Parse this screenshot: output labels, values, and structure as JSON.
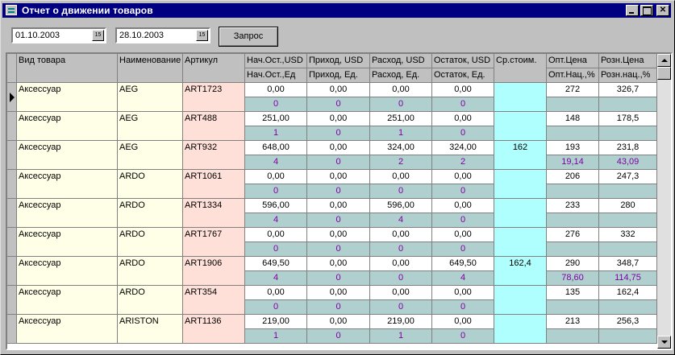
{
  "window": {
    "title": "Отчет о движении товаров"
  },
  "toolbar": {
    "date_from": "01.10.2003",
    "date_to": "28.10.2003",
    "calendar_label": "15",
    "query_label": "Запрос"
  },
  "grid": {
    "headers": {
      "type": "Вид товара",
      "name": "Наименование",
      "article": "Артикул",
      "start_usd": "Нач.Ост.,USD",
      "start_units": "Нач.Ост.,Ед",
      "in_usd": "Приход, USD",
      "in_units": "Приход, Ед.",
      "out_usd": "Расход, USD",
      "out_units": "Расход, Ед.",
      "rest_usd": "Остаток, USD",
      "rest_units": "Остаток, Ед.",
      "avg_cost": "Ср.стоим.",
      "wholesale_price": "Опт.Цена",
      "wholesale_markup": "Опт.Нац.,%",
      "retail_price": "Розн.Цена",
      "retail_markup": "Розн.нац.,%"
    },
    "rows": [
      {
        "type": "Аксессуар",
        "name": "AEG",
        "article": "ART1723",
        "start_usd": "0,00",
        "start_units": "0",
        "in_usd": "0,00",
        "in_units": "0",
        "out_usd": "0,00",
        "out_units": "0",
        "rest_usd": "0,00",
        "rest_units": "0",
        "avg_cost": "",
        "wholesale_price": "272",
        "wholesale_markup": "",
        "retail_price": "326,7",
        "retail_markup": ""
      },
      {
        "type": "Аксессуар",
        "name": "AEG",
        "article": "ART488",
        "start_usd": "251,00",
        "start_units": "1",
        "in_usd": "0,00",
        "in_units": "0",
        "out_usd": "251,00",
        "out_units": "1",
        "rest_usd": "0,00",
        "rest_units": "0",
        "avg_cost": "",
        "wholesale_price": "148",
        "wholesale_markup": "",
        "retail_price": "178,5",
        "retail_markup": ""
      },
      {
        "type": "Аксессуар",
        "name": "AEG",
        "article": "ART932",
        "start_usd": "648,00",
        "start_units": "4",
        "in_usd": "0,00",
        "in_units": "0",
        "out_usd": "324,00",
        "out_units": "2",
        "rest_usd": "324,00",
        "rest_units": "2",
        "avg_cost": "162",
        "wholesale_price": "193",
        "wholesale_markup": "19,14",
        "retail_price": "231,8",
        "retail_markup": "43,09"
      },
      {
        "type": "Аксессуар",
        "name": "ARDO",
        "article": "ART1061",
        "start_usd": "0,00",
        "start_units": "0",
        "in_usd": "0,00",
        "in_units": "0",
        "out_usd": "0,00",
        "out_units": "0",
        "rest_usd": "0,00",
        "rest_units": "0",
        "avg_cost": "",
        "wholesale_price": "206",
        "wholesale_markup": "",
        "retail_price": "247,3",
        "retail_markup": ""
      },
      {
        "type": "Аксессуар",
        "name": "ARDO",
        "article": "ART1334",
        "start_usd": "596,00",
        "start_units": "4",
        "in_usd": "0,00",
        "in_units": "0",
        "out_usd": "596,00",
        "out_units": "4",
        "rest_usd": "0,00",
        "rest_units": "0",
        "avg_cost": "",
        "wholesale_price": "233",
        "wholesale_markup": "",
        "retail_price": "280",
        "retail_markup": ""
      },
      {
        "type": "Аксессуар",
        "name": "ARDO",
        "article": "ART1767",
        "start_usd": "0,00",
        "start_units": "0",
        "in_usd": "0,00",
        "in_units": "0",
        "out_usd": "0,00",
        "out_units": "0",
        "rest_usd": "0,00",
        "rest_units": "0",
        "avg_cost": "",
        "wholesale_price": "276",
        "wholesale_markup": "",
        "retail_price": "332",
        "retail_markup": ""
      },
      {
        "type": "Аксессуар",
        "name": "ARDO",
        "article": "ART1906",
        "start_usd": "649,50",
        "start_units": "4",
        "in_usd": "0,00",
        "in_units": "0",
        "out_usd": "0,00",
        "out_units": "0",
        "rest_usd": "649,50",
        "rest_units": "4",
        "avg_cost": "162,4",
        "wholesale_price": "290",
        "wholesale_markup": "78,60",
        "retail_price": "348,7",
        "retail_markup": "114,75"
      },
      {
        "type": "Аксессуар",
        "name": "ARDO",
        "article": "ART354",
        "start_usd": "0,00",
        "start_units": "0",
        "in_usd": "0,00",
        "in_units": "0",
        "out_usd": "0,00",
        "out_units": "0",
        "rest_usd": "0,00",
        "rest_units": "0",
        "avg_cost": "",
        "wholesale_price": "135",
        "wholesale_markup": "",
        "retail_price": "162,4",
        "retail_markup": ""
      },
      {
        "type": "Аксессуар",
        "name": "ARISTON",
        "article": "ART1136",
        "start_usd": "219,00",
        "start_units": "1",
        "in_usd": "0,00",
        "in_units": "0",
        "out_usd": "219,00",
        "out_units": "1",
        "rest_usd": "0,00",
        "rest_units": "0",
        "avg_cost": "",
        "wholesale_price": "213",
        "wholesale_markup": "",
        "retail_price": "256,3",
        "retail_markup": ""
      }
    ]
  }
}
